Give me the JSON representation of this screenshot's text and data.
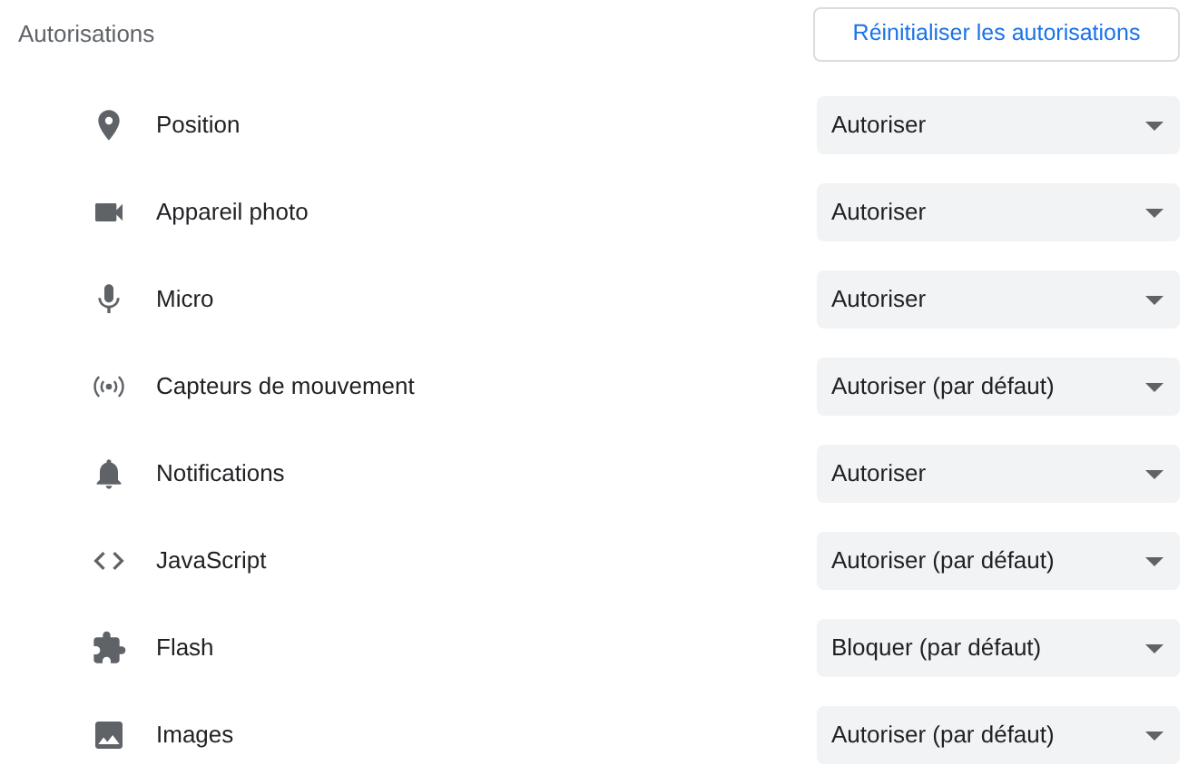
{
  "section": {
    "title": "Autorisations",
    "reset_button": "Réinitialiser les autorisations"
  },
  "permissions": [
    {
      "kind": "location",
      "label": "Position",
      "value": "Autoriser"
    },
    {
      "kind": "camera",
      "label": "Appareil photo",
      "value": "Autoriser"
    },
    {
      "kind": "microphone",
      "label": "Micro",
      "value": "Autoriser"
    },
    {
      "kind": "sensors",
      "label": "Capteurs de mouvement",
      "value": "Autoriser (par défaut)"
    },
    {
      "kind": "notifications",
      "label": "Notifications",
      "value": "Autoriser"
    },
    {
      "kind": "javascript",
      "label": "JavaScript",
      "value": "Autoriser (par défaut)"
    },
    {
      "kind": "flash",
      "label": "Flash",
      "value": "Bloquer (par défaut)"
    },
    {
      "kind": "images",
      "label": "Images",
      "value": "Autoriser (par défaut)"
    }
  ]
}
